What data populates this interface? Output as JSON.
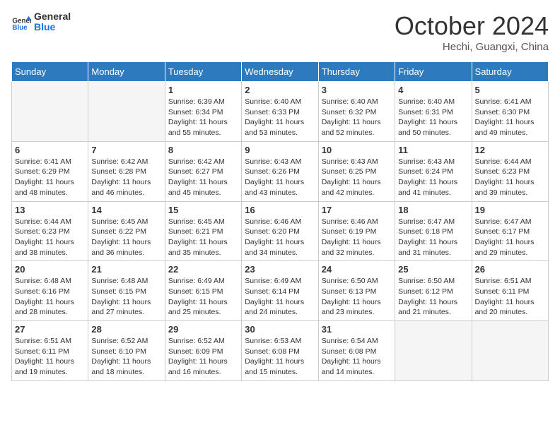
{
  "header": {
    "logo_general": "General",
    "logo_blue": "Blue",
    "month": "October 2024",
    "location": "Hechi, Guangxi, China"
  },
  "weekdays": [
    "Sunday",
    "Monday",
    "Tuesday",
    "Wednesday",
    "Thursday",
    "Friday",
    "Saturday"
  ],
  "weeks": [
    [
      {
        "day": "",
        "info": ""
      },
      {
        "day": "",
        "info": ""
      },
      {
        "day": "1",
        "info": "Sunrise: 6:39 AM\nSunset: 6:34 PM\nDaylight: 11 hours and 55 minutes."
      },
      {
        "day": "2",
        "info": "Sunrise: 6:40 AM\nSunset: 6:33 PM\nDaylight: 11 hours and 53 minutes."
      },
      {
        "day": "3",
        "info": "Sunrise: 6:40 AM\nSunset: 6:32 PM\nDaylight: 11 hours and 52 minutes."
      },
      {
        "day": "4",
        "info": "Sunrise: 6:40 AM\nSunset: 6:31 PM\nDaylight: 11 hours and 50 minutes."
      },
      {
        "day": "5",
        "info": "Sunrise: 6:41 AM\nSunset: 6:30 PM\nDaylight: 11 hours and 49 minutes."
      }
    ],
    [
      {
        "day": "6",
        "info": "Sunrise: 6:41 AM\nSunset: 6:29 PM\nDaylight: 11 hours and 48 minutes."
      },
      {
        "day": "7",
        "info": "Sunrise: 6:42 AM\nSunset: 6:28 PM\nDaylight: 11 hours and 46 minutes."
      },
      {
        "day": "8",
        "info": "Sunrise: 6:42 AM\nSunset: 6:27 PM\nDaylight: 11 hours and 45 minutes."
      },
      {
        "day": "9",
        "info": "Sunrise: 6:43 AM\nSunset: 6:26 PM\nDaylight: 11 hours and 43 minutes."
      },
      {
        "day": "10",
        "info": "Sunrise: 6:43 AM\nSunset: 6:25 PM\nDaylight: 11 hours and 42 minutes."
      },
      {
        "day": "11",
        "info": "Sunrise: 6:43 AM\nSunset: 6:24 PM\nDaylight: 11 hours and 41 minutes."
      },
      {
        "day": "12",
        "info": "Sunrise: 6:44 AM\nSunset: 6:23 PM\nDaylight: 11 hours and 39 minutes."
      }
    ],
    [
      {
        "day": "13",
        "info": "Sunrise: 6:44 AM\nSunset: 6:23 PM\nDaylight: 11 hours and 38 minutes."
      },
      {
        "day": "14",
        "info": "Sunrise: 6:45 AM\nSunset: 6:22 PM\nDaylight: 11 hours and 36 minutes."
      },
      {
        "day": "15",
        "info": "Sunrise: 6:45 AM\nSunset: 6:21 PM\nDaylight: 11 hours and 35 minutes."
      },
      {
        "day": "16",
        "info": "Sunrise: 6:46 AM\nSunset: 6:20 PM\nDaylight: 11 hours and 34 minutes."
      },
      {
        "day": "17",
        "info": "Sunrise: 6:46 AM\nSunset: 6:19 PM\nDaylight: 11 hours and 32 minutes."
      },
      {
        "day": "18",
        "info": "Sunrise: 6:47 AM\nSunset: 6:18 PM\nDaylight: 11 hours and 31 minutes."
      },
      {
        "day": "19",
        "info": "Sunrise: 6:47 AM\nSunset: 6:17 PM\nDaylight: 11 hours and 29 minutes."
      }
    ],
    [
      {
        "day": "20",
        "info": "Sunrise: 6:48 AM\nSunset: 6:16 PM\nDaylight: 11 hours and 28 minutes."
      },
      {
        "day": "21",
        "info": "Sunrise: 6:48 AM\nSunset: 6:15 PM\nDaylight: 11 hours and 27 minutes."
      },
      {
        "day": "22",
        "info": "Sunrise: 6:49 AM\nSunset: 6:15 PM\nDaylight: 11 hours and 25 minutes."
      },
      {
        "day": "23",
        "info": "Sunrise: 6:49 AM\nSunset: 6:14 PM\nDaylight: 11 hours and 24 minutes."
      },
      {
        "day": "24",
        "info": "Sunrise: 6:50 AM\nSunset: 6:13 PM\nDaylight: 11 hours and 23 minutes."
      },
      {
        "day": "25",
        "info": "Sunrise: 6:50 AM\nSunset: 6:12 PM\nDaylight: 11 hours and 21 minutes."
      },
      {
        "day": "26",
        "info": "Sunrise: 6:51 AM\nSunset: 6:11 PM\nDaylight: 11 hours and 20 minutes."
      }
    ],
    [
      {
        "day": "27",
        "info": "Sunrise: 6:51 AM\nSunset: 6:11 PM\nDaylight: 11 hours and 19 minutes."
      },
      {
        "day": "28",
        "info": "Sunrise: 6:52 AM\nSunset: 6:10 PM\nDaylight: 11 hours and 18 minutes."
      },
      {
        "day": "29",
        "info": "Sunrise: 6:52 AM\nSunset: 6:09 PM\nDaylight: 11 hours and 16 minutes."
      },
      {
        "day": "30",
        "info": "Sunrise: 6:53 AM\nSunset: 6:08 PM\nDaylight: 11 hours and 15 minutes."
      },
      {
        "day": "31",
        "info": "Sunrise: 6:54 AM\nSunset: 6:08 PM\nDaylight: 11 hours and 14 minutes."
      },
      {
        "day": "",
        "info": ""
      },
      {
        "day": "",
        "info": ""
      }
    ]
  ]
}
